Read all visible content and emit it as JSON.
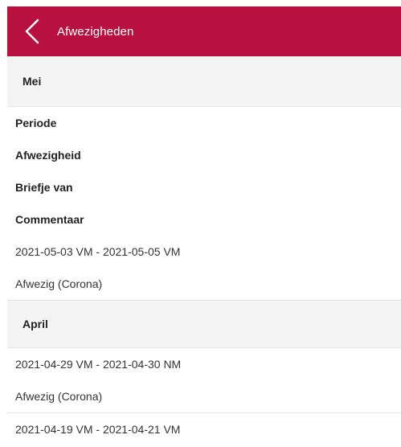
{
  "header": {
    "title": "Afwezigheden",
    "back_icon": "chevron-left-icon",
    "color": "#b8103f"
  },
  "sections": [
    {
      "month": "Mei",
      "labels": [
        "Periode",
        "Afwezigheid",
        "Briefje van",
        "Commentaar"
      ],
      "entries": [
        {
          "period": "2021-05-03 VM - 2021-05-05 VM",
          "absence": "Afwezig (Corona)"
        }
      ]
    },
    {
      "month": "April",
      "entries": [
        {
          "period": "2021-04-29 VM - 2021-04-30 NM",
          "absence": "Afwezig (Corona)"
        },
        {
          "period": "2021-04-19 VM - 2021-04-21 VM"
        }
      ]
    }
  ]
}
